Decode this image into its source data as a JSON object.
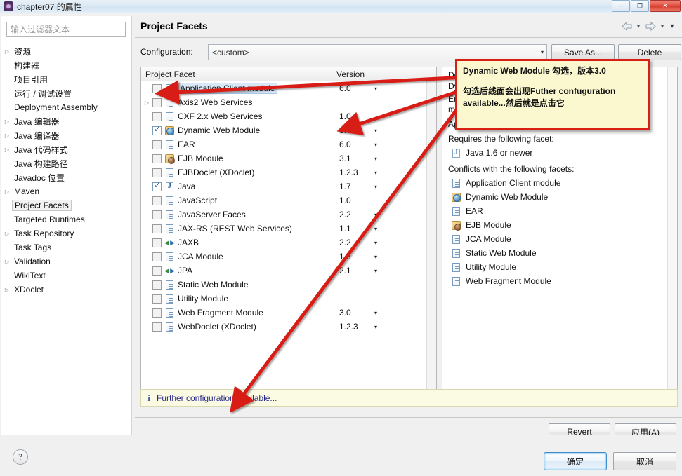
{
  "window": {
    "title": "chapter07 的属性",
    "icon": "eclipse-project-icon",
    "buttons": {
      "minimize": "–",
      "maximize": "❐",
      "close": "✕"
    }
  },
  "sidebar": {
    "filter_placeholder": "输入过滤器文本",
    "items": [
      {
        "label": "资源",
        "expandable": true,
        "selected": false
      },
      {
        "label": "构建器",
        "expandable": false,
        "selected": false
      },
      {
        "label": "项目引用",
        "expandable": false,
        "selected": false
      },
      {
        "label": "运行 / 调试设置",
        "expandable": false,
        "selected": false
      },
      {
        "label": "Deployment Assembly",
        "expandable": false,
        "selected": false
      },
      {
        "label": "Java 编辑器",
        "expandable": true,
        "selected": false
      },
      {
        "label": "Java 编译器",
        "expandable": true,
        "selected": false
      },
      {
        "label": "Java 代码样式",
        "expandable": true,
        "selected": false
      },
      {
        "label": "Java 构建路径",
        "expandable": false,
        "selected": false
      },
      {
        "label": "Javadoc 位置",
        "expandable": false,
        "selected": false
      },
      {
        "label": "Maven",
        "expandable": true,
        "selected": false
      },
      {
        "label": "Project Facets",
        "expandable": false,
        "selected": true
      },
      {
        "label": "Targeted Runtimes",
        "expandable": false,
        "selected": false
      },
      {
        "label": "Task Repository",
        "expandable": true,
        "selected": false
      },
      {
        "label": "Task Tags",
        "expandable": false,
        "selected": false
      },
      {
        "label": "Validation",
        "expandable": true,
        "selected": false
      },
      {
        "label": "WikiText",
        "expandable": false,
        "selected": false
      },
      {
        "label": "XDoclet",
        "expandable": true,
        "selected": false
      }
    ]
  },
  "page": {
    "title": "Project Facets",
    "toolbar": {
      "back": "back-arrow-icon",
      "back_menu": "chevron-down-icon",
      "forward": "forward-arrow-icon",
      "forward_menu": "chevron-down-icon",
      "view_menu": "chevron-down-icon"
    }
  },
  "configuration": {
    "label": "Configuration:",
    "value": "<custom>",
    "save_as_label": "Save As...",
    "delete_label": "Delete"
  },
  "facets_table": {
    "columns": [
      "Project Facet",
      "Version"
    ],
    "rows": [
      {
        "name": "Application Client module",
        "version": "6.0",
        "checked": false,
        "expandable": false,
        "selected": true,
        "icon": "doc-icon",
        "has_version_caret": true
      },
      {
        "name": "Axis2 Web Services",
        "version": "",
        "checked": false,
        "expandable": true,
        "selected": false,
        "icon": "doc-icon",
        "has_version_caret": false
      },
      {
        "name": "CXF 2.x Web Services",
        "version": "1.0",
        "checked": false,
        "expandable": false,
        "selected": false,
        "icon": "doc-icon",
        "has_version_caret": false
      },
      {
        "name": "Dynamic Web Module",
        "version": "3.0",
        "checked": true,
        "expandable": false,
        "selected": false,
        "icon": "web-module-icon",
        "has_version_caret": true
      },
      {
        "name": "EAR",
        "version": "6.0",
        "checked": false,
        "expandable": false,
        "selected": false,
        "icon": "doc-icon",
        "has_version_caret": true
      },
      {
        "name": "EJB Module",
        "version": "3.1",
        "checked": false,
        "expandable": false,
        "selected": false,
        "icon": "ejb-icon",
        "has_version_caret": true
      },
      {
        "name": "EJBDoclet (XDoclet)",
        "version": "1.2.3",
        "checked": false,
        "expandable": false,
        "selected": false,
        "icon": "doc-icon",
        "has_version_caret": true
      },
      {
        "name": "Java",
        "version": "1.7",
        "checked": true,
        "expandable": false,
        "selected": false,
        "icon": "java-icon",
        "has_version_caret": true
      },
      {
        "name": "JavaScript",
        "version": "1.0",
        "checked": false,
        "expandable": false,
        "selected": false,
        "icon": "doc-icon",
        "has_version_caret": false
      },
      {
        "name": "JavaServer Faces",
        "version": "2.2",
        "checked": false,
        "expandable": false,
        "selected": false,
        "icon": "doc-icon",
        "has_version_caret": true
      },
      {
        "name": "JAX-RS (REST Web Services)",
        "version": "1.1",
        "checked": false,
        "expandable": false,
        "selected": false,
        "icon": "doc-icon",
        "has_version_caret": true
      },
      {
        "name": "JAXB",
        "version": "2.2",
        "checked": false,
        "expandable": false,
        "selected": false,
        "icon": "arrows-icon",
        "has_version_caret": true
      },
      {
        "name": "JCA Module",
        "version": "1.6",
        "checked": false,
        "expandable": false,
        "selected": false,
        "icon": "doc-icon",
        "has_version_caret": true
      },
      {
        "name": "JPA",
        "version": "2.1",
        "checked": false,
        "expandable": false,
        "selected": false,
        "icon": "arrows-icon",
        "has_version_caret": true
      },
      {
        "name": "Static Web Module",
        "version": "",
        "checked": false,
        "expandable": false,
        "selected": false,
        "icon": "doc-icon",
        "has_version_caret": false
      },
      {
        "name": "Utility Module",
        "version": "",
        "checked": false,
        "expandable": false,
        "selected": false,
        "icon": "doc-icon",
        "has_version_caret": false
      },
      {
        "name": "Web Fragment Module",
        "version": "3.0",
        "checked": false,
        "expandable": false,
        "selected": false,
        "icon": "doc-icon",
        "has_version_caret": true
      },
      {
        "name": "WebDoclet (XDoclet)",
        "version": "1.2.3",
        "checked": false,
        "expandable": false,
        "selected": false,
        "icon": "doc-icon",
        "has_version_caret": true
      }
    ]
  },
  "details": {
    "header": "Details",
    "facet_title": "Dynamic Web Module",
    "description_1": "Enables the project to be deployed as a dynamic web module.",
    "description_2": "Application Client module",
    "requires_label": "Requires the following facet:",
    "requires": [
      {
        "label": "Java 1.6 or newer",
        "icon": "java-icon"
      }
    ],
    "conflicts_label": "Conflicts with the following facets:",
    "conflicts": [
      {
        "label": "Application Client module",
        "icon": "doc-icon"
      },
      {
        "label": "Dynamic Web Module",
        "icon": "web-module-icon"
      },
      {
        "label": "EAR",
        "icon": "doc-icon"
      },
      {
        "label": "EJB Module",
        "icon": "ejb-icon"
      },
      {
        "label": "JCA Module",
        "icon": "doc-icon"
      },
      {
        "label": "Static Web Module",
        "icon": "doc-icon"
      },
      {
        "label": "Utility Module",
        "icon": "doc-icon"
      },
      {
        "label": "Web Fragment Module",
        "icon": "doc-icon"
      }
    ]
  },
  "info_bar": {
    "icon": "info-icon",
    "link_text": "Further configuration available..."
  },
  "buttons": {
    "revert": "Revert",
    "apply": "应用(A)",
    "ok": "确定",
    "cancel": "取消",
    "help": "?"
  },
  "annotation": {
    "line1": "Dynamic Web Module 勾选，版本3.0",
    "line2": "勾选后线面会出现Futher confuguration",
    "line3": "available...然后就是点击它",
    "box_color": "#fbf8cf",
    "border_color": "#d81f13",
    "arrow_color": "#d81f13"
  }
}
